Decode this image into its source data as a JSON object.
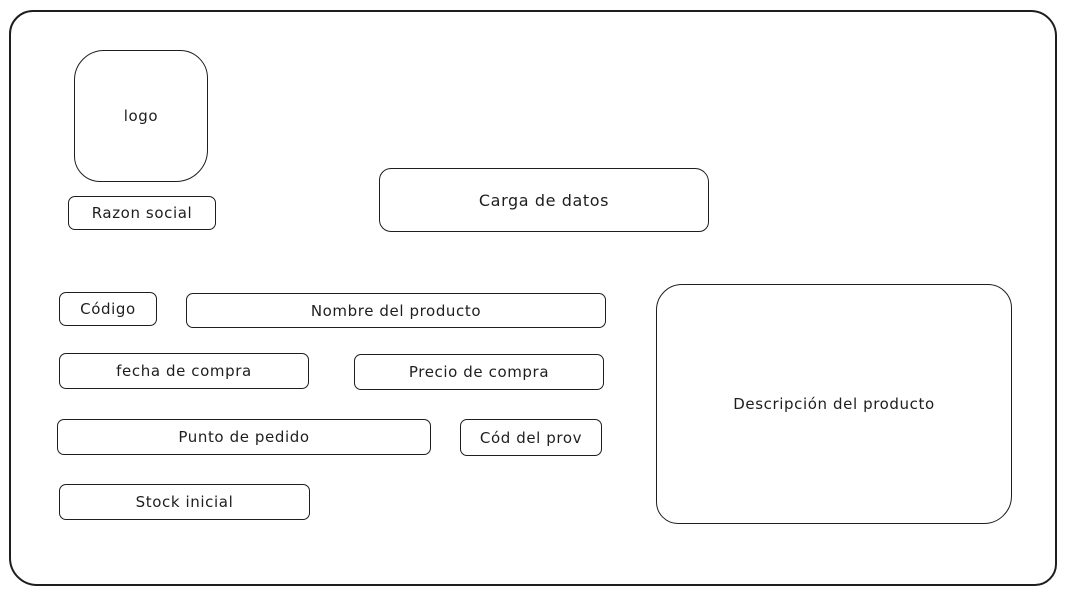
{
  "wireframe": {
    "logo": "logo",
    "razon_social": "Razon social",
    "carga_de_datos": "Carga de datos",
    "codigo": "Código",
    "nombre_producto": "Nombre del producto",
    "fecha_compra": "fecha de compra",
    "precio_compra": "Precio de compra",
    "punto_pedido": "Punto de pedido",
    "cod_prov": "Cód del prov",
    "stock_inicial": "Stock inicial",
    "descripcion_producto": "Descripción del producto"
  },
  "colors": {
    "stroke": "#1e1e1e",
    "background": "#ffffff"
  }
}
